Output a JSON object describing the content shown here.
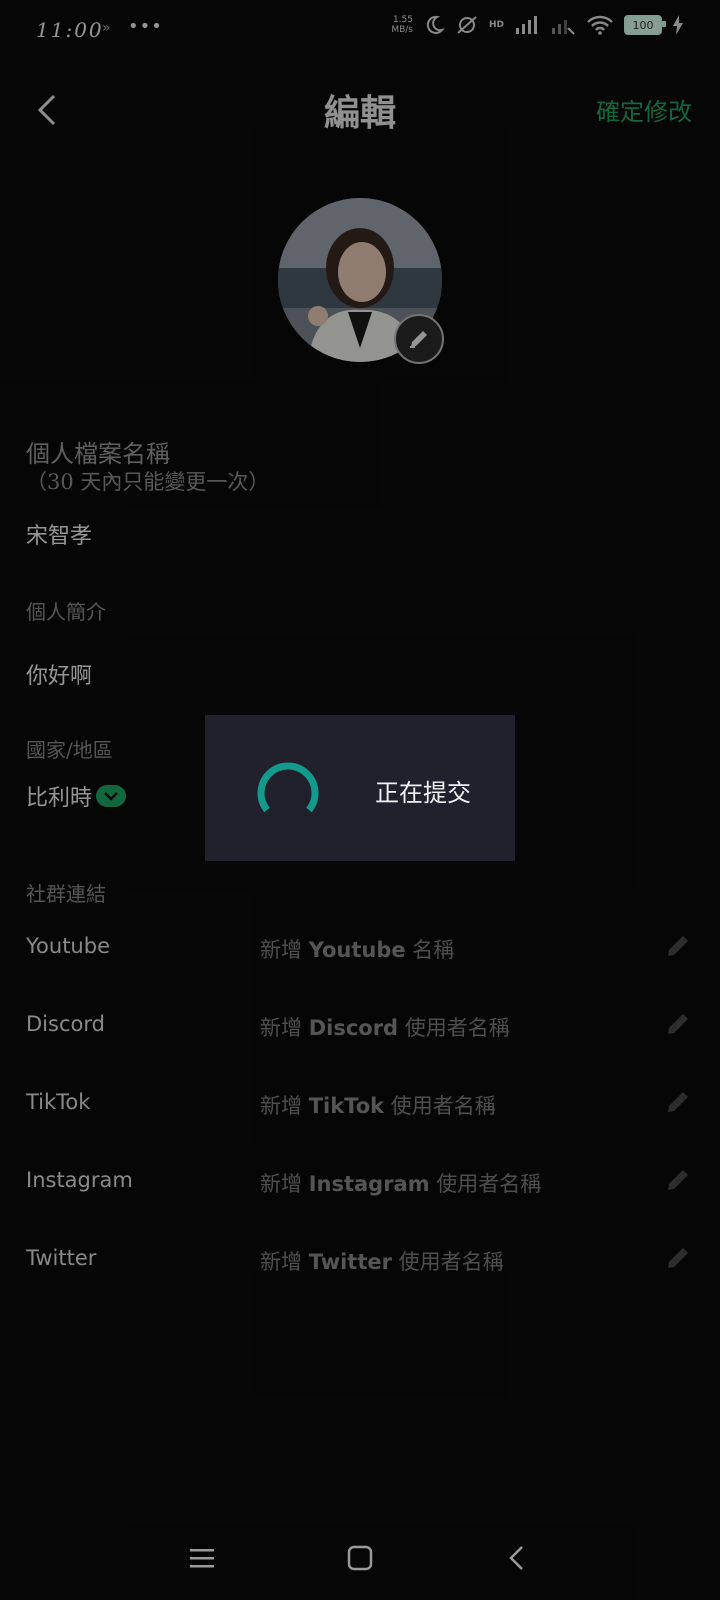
{
  "status_bar": {
    "time": "11:00",
    "extra_glyph": "»",
    "dots": "•••",
    "speed_value": "1.55",
    "speed_unit": "MB/s",
    "hd": "HD",
    "battery": "100"
  },
  "header": {
    "title": "編輯",
    "confirm_label": "確定修改"
  },
  "profile": {
    "name_label": "個人檔案名稱",
    "name_note": "（30 天內只能變更一次）",
    "name_value": "宋智孝",
    "bio_label": "個人簡介",
    "bio_value": "你好啊",
    "region_label": "國家/地區",
    "region_value": "比利時"
  },
  "social": {
    "section_label": "社群連結",
    "prefix": "新增",
    "links": [
      {
        "name": "Youtube",
        "bold": "Youtube",
        "suffix": "名稱"
      },
      {
        "name": "Discord",
        "bold": "Discord",
        "suffix": "使用者名稱"
      },
      {
        "name": "TikTok",
        "bold": "TikTok",
        "suffix": "使用者名稱"
      },
      {
        "name": "Instagram",
        "bold": "Instagram",
        "suffix": "使用者名稱"
      },
      {
        "name": "Twitter",
        "bold": "Twitter",
        "suffix": "使用者名稱"
      }
    ]
  },
  "dialog": {
    "text": "正在提交"
  },
  "colors": {
    "accent": "#1ea765",
    "spinner": "#129a8c",
    "dialog_bg": "#20212c"
  }
}
